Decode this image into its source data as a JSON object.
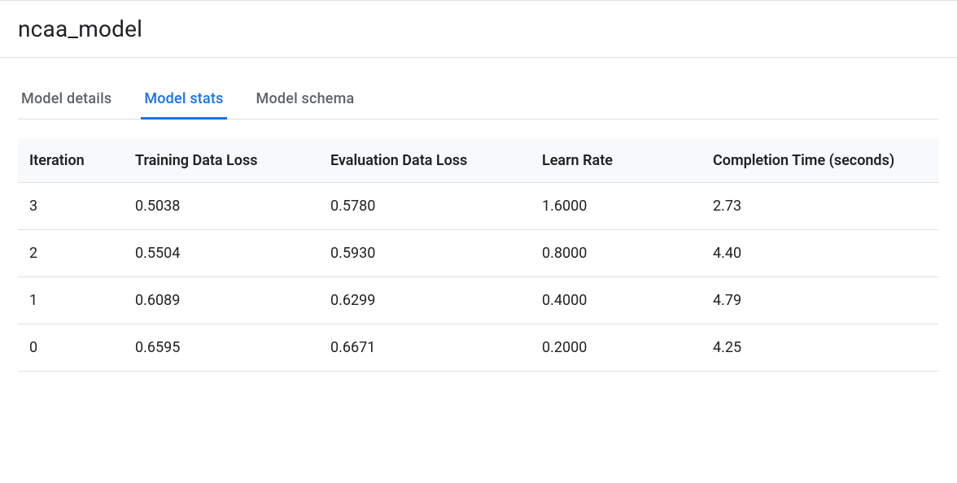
{
  "header": {
    "title": "ncaa_model"
  },
  "tabs": [
    {
      "label": "Model details",
      "active": false
    },
    {
      "label": "Model stats",
      "active": true
    },
    {
      "label": "Model schema",
      "active": false
    }
  ],
  "table": {
    "columns": [
      "Iteration",
      "Training Data Loss",
      "Evaluation Data Loss",
      "Learn Rate",
      "Completion Time (seconds)"
    ],
    "rows": [
      {
        "iteration": "3",
        "training_loss": "0.5038",
        "eval_loss": "0.5780",
        "learn_rate": "1.6000",
        "completion_time": "2.73"
      },
      {
        "iteration": "2",
        "training_loss": "0.5504",
        "eval_loss": "0.5930",
        "learn_rate": "0.8000",
        "completion_time": "4.40"
      },
      {
        "iteration": "1",
        "training_loss": "0.6089",
        "eval_loss": "0.6299",
        "learn_rate": "0.4000",
        "completion_time": "4.79"
      },
      {
        "iteration": "0",
        "training_loss": "0.6595",
        "eval_loss": "0.6671",
        "learn_rate": "0.2000",
        "completion_time": "4.25"
      }
    ]
  }
}
